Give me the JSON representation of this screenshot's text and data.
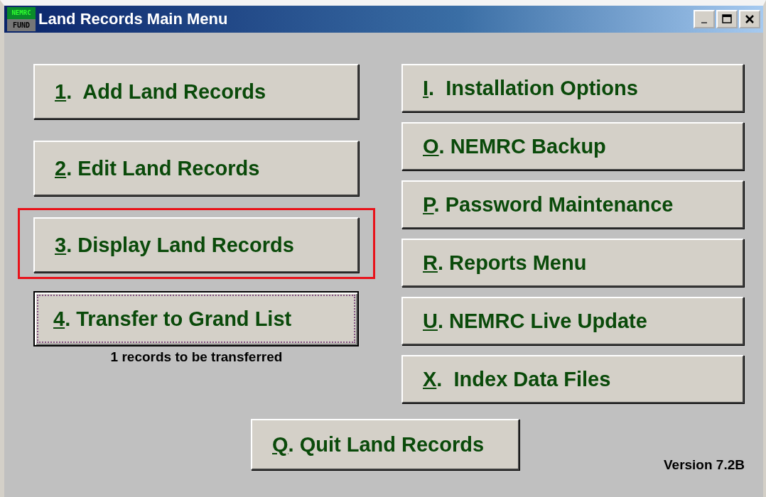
{
  "window": {
    "title": "Land Records Main Menu",
    "logo": {
      "top": "NEMRC",
      "bottom": "FUND"
    }
  },
  "left_buttons": [
    {
      "key": "1",
      "rest": ".  Add Land Records",
      "highlighted": false,
      "focused": false
    },
    {
      "key": "2",
      "rest": ". Edit Land Records",
      "highlighted": false,
      "focused": false
    },
    {
      "key": "3",
      "rest": ". Display Land Records",
      "highlighted": true,
      "focused": false
    },
    {
      "key": "4",
      "rest": ". Transfer to Grand List",
      "highlighted": false,
      "focused": true,
      "note": "1 records to be transferred"
    }
  ],
  "right_buttons": [
    {
      "key": "I",
      "rest": ".  Installation Options"
    },
    {
      "key": "O",
      "rest": ". NEMRC Backup"
    },
    {
      "key": "P",
      "rest": ". Password Maintenance"
    },
    {
      "key": "R",
      "rest": ". Reports Menu"
    },
    {
      "key": "U",
      "rest": ". NEMRC Live Update"
    },
    {
      "key": "X",
      "rest": ".  Index Data Files"
    }
  ],
  "quit_button": {
    "key": "Q",
    "rest": ". Quit Land Records"
  },
  "version": "Version 7.2B"
}
